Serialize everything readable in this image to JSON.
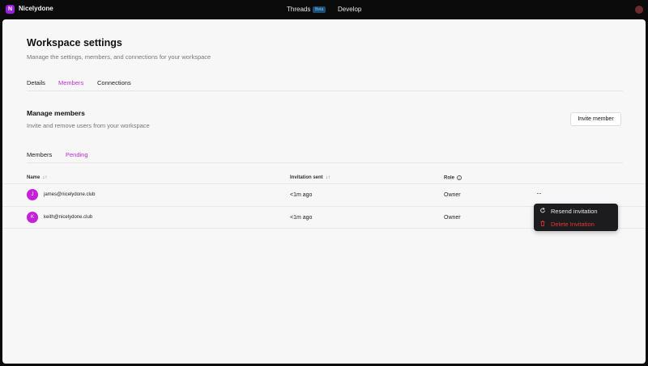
{
  "topbar": {
    "logo_letter": "N",
    "brand": "Nicelydone",
    "nav": [
      {
        "label": "Threads",
        "badge": "Beta"
      },
      {
        "label": "Develop"
      }
    ]
  },
  "page": {
    "title": "Workspace settings",
    "subtitle": "Manage the settings, members, and connections for your workspace",
    "tabs": [
      {
        "label": "Details",
        "active": false
      },
      {
        "label": "Members",
        "active": true
      },
      {
        "label": "Connections",
        "active": false
      }
    ]
  },
  "section": {
    "title": "Manage members",
    "subtitle": "Invite and remove users from your workspace",
    "invite_button": "Invite member",
    "subtabs": [
      {
        "label": "Members",
        "active": false
      },
      {
        "label": "Pending",
        "active": true
      }
    ]
  },
  "table": {
    "columns": [
      "Name",
      "Invitation sent",
      "Role"
    ],
    "sort_glyph": "↓↑",
    "more_glyph": "···",
    "rows": [
      {
        "initial": "J",
        "email": "james@nicelydone.club",
        "sent": "<1m ago",
        "role": "Owner"
      },
      {
        "initial": "K",
        "email": "keith@nicelydone.club",
        "sent": "<1m ago",
        "role": "Owner"
      }
    ]
  },
  "menu": {
    "items": [
      {
        "label": "Resend invitation",
        "icon": "refresh-icon"
      },
      {
        "label": "Delete Invitation",
        "icon": "trash-icon",
        "color": "#e53636"
      }
    ]
  },
  "colors": {
    "accent": "#c02cdc",
    "avatar": "#c421d8",
    "danger": "#e53636",
    "topbar": "#0b0b0c",
    "badge_bg": "#1e4f74"
  }
}
